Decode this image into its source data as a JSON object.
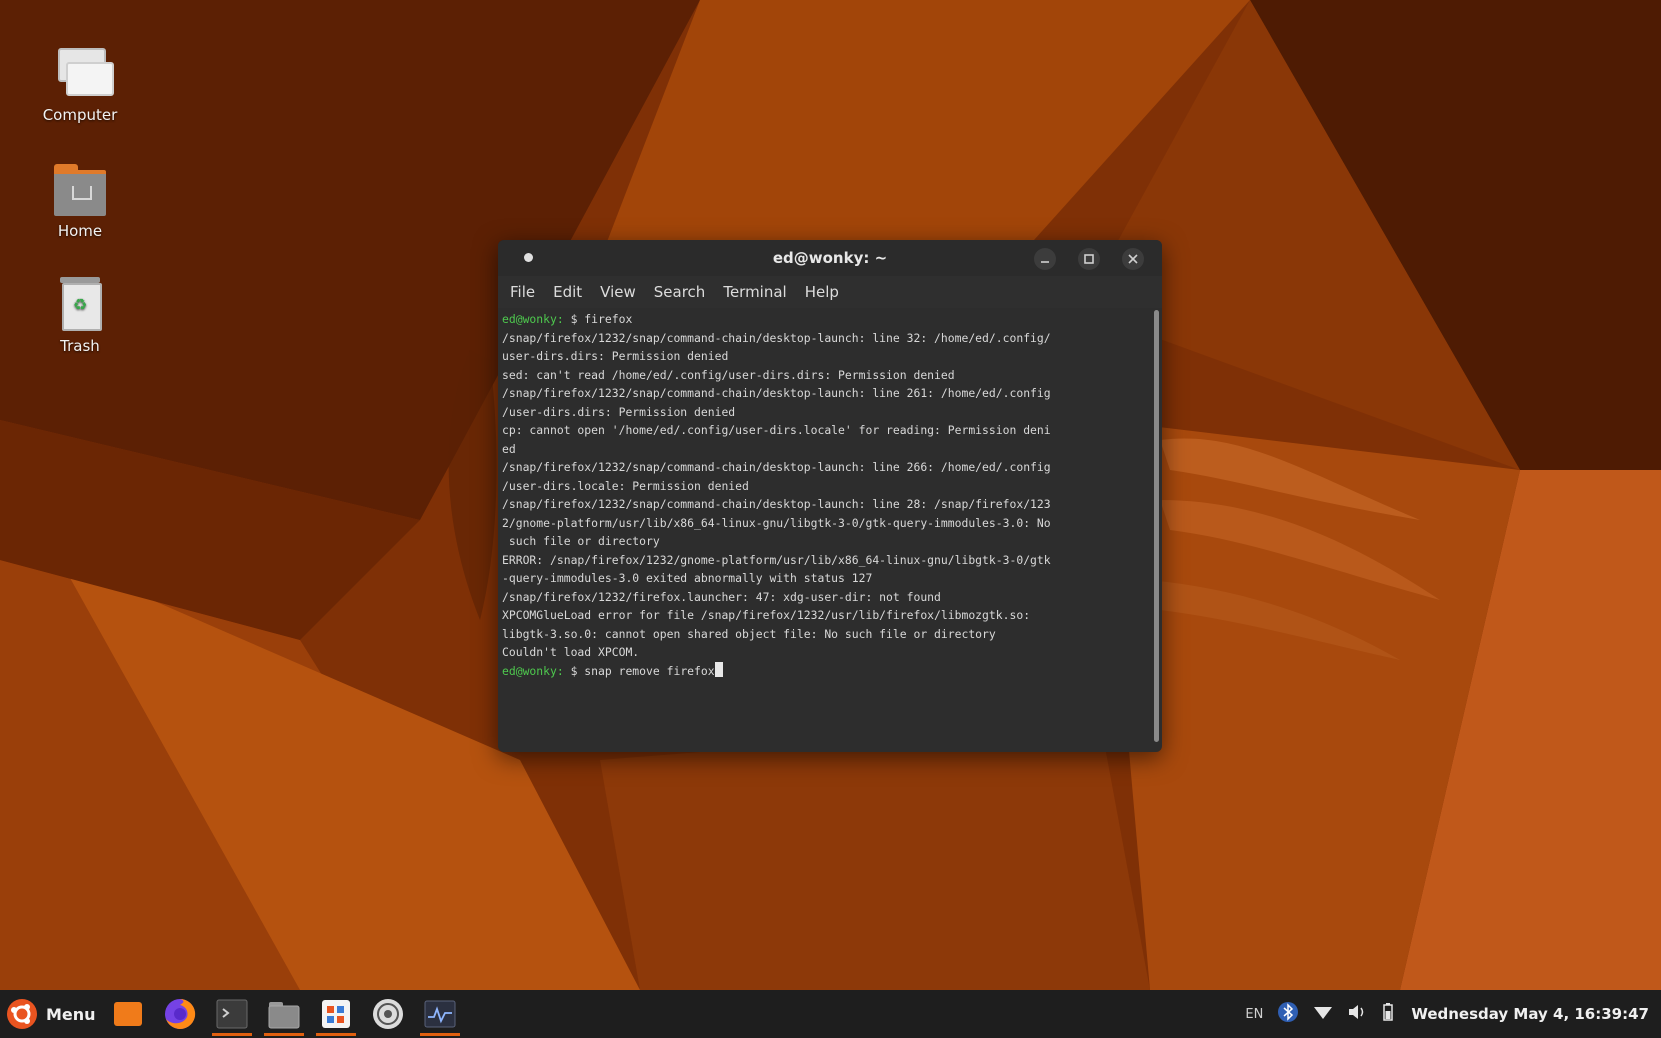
{
  "desktop": {
    "icons": [
      {
        "label": "Computer"
      },
      {
        "label": "Home"
      },
      {
        "label": "Trash"
      }
    ]
  },
  "terminal": {
    "title": "ed@wonky: ~",
    "menu": [
      "File",
      "Edit",
      "View",
      "Search",
      "Terminal",
      "Help"
    ],
    "output": [
      {
        "prompt": "ed@wonky:",
        "text": " $ firefox"
      },
      {
        "text": "/snap/firefox/1232/snap/command-chain/desktop-launch: line 32: /home/ed/.config/"
      },
      {
        "text": "user-dirs.dirs: Permission denied"
      },
      {
        "text": "sed: can't read /home/ed/.config/user-dirs.dirs: Permission denied"
      },
      {
        "text": "/snap/firefox/1232/snap/command-chain/desktop-launch: line 261: /home/ed/.config"
      },
      {
        "text": "/user-dirs.dirs: Permission denied"
      },
      {
        "text": "cp: cannot open '/home/ed/.config/user-dirs.locale' for reading: Permission deni"
      },
      {
        "text": "ed"
      },
      {
        "text": "/snap/firefox/1232/snap/command-chain/desktop-launch: line 266: /home/ed/.config"
      },
      {
        "text": "/user-dirs.locale: Permission denied"
      },
      {
        "text": "/snap/firefox/1232/snap/command-chain/desktop-launch: line 28: /snap/firefox/123"
      },
      {
        "text": "2/gnome-platform/usr/lib/x86_64-linux-gnu/libgtk-3-0/gtk-query-immodules-3.0: No"
      },
      {
        "text": " such file or directory"
      },
      {
        "text": "ERROR: /snap/firefox/1232/gnome-platform/usr/lib/x86_64-linux-gnu/libgtk-3-0/gtk"
      },
      {
        "text": "-query-immodules-3.0 exited abnormally with status 127"
      },
      {
        "text": "/snap/firefox/1232/firefox.launcher: 47: xdg-user-dir: not found"
      },
      {
        "text": "XPCOMGlueLoad error for file /snap/firefox/1232/usr/lib/firefox/libmozgtk.so:"
      },
      {
        "text": "libgtk-3.so.0: cannot open shared object file: No such file or directory"
      },
      {
        "text": "Couldn't load XPCOM."
      },
      {
        "prompt": "ed@wonky:",
        "text": " $ snap remove firefox",
        "cursor": true
      }
    ]
  },
  "taskbar": {
    "menu_label": "Menu",
    "apps": [
      {
        "name": "files-orange",
        "active": false
      },
      {
        "name": "firefox",
        "active": false
      },
      {
        "name": "terminal",
        "active": true
      },
      {
        "name": "file-manager",
        "active": true
      },
      {
        "name": "software-center",
        "active": true
      },
      {
        "name": "disks",
        "active": false
      },
      {
        "name": "system-monitor",
        "active": true
      }
    ],
    "tray": {
      "keyboard": "EN",
      "clock": "Wednesday May 4, 16:39:47"
    }
  },
  "colors": {
    "accent": "#e06010",
    "prompt": "#4ec94e",
    "wallpaper_base": "#7a2c05"
  }
}
